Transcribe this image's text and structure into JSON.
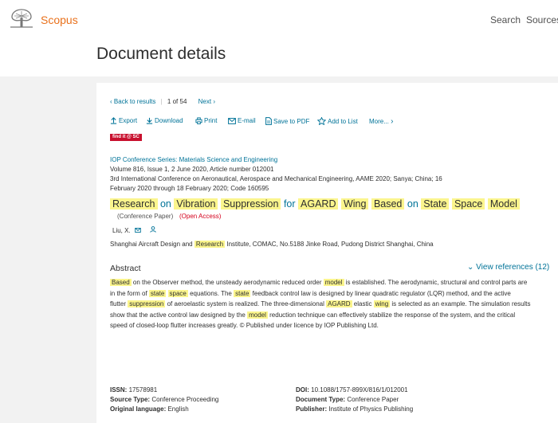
{
  "header": {
    "brand": "Scopus",
    "nav": {
      "search": "Search",
      "sources": "Sources"
    }
  },
  "page": {
    "title": "Document details"
  },
  "resultnav": {
    "back": "Back to results",
    "current": "1",
    "of": "of",
    "total": "54",
    "next": "Next"
  },
  "toolbar": {
    "export": "Export",
    "download": "Download",
    "print": "Print",
    "email": "E-mail",
    "save_pdf": "Save to PDF",
    "add_list": "Add to List",
    "more": "More..."
  },
  "findit": "find it @ SC",
  "source": {
    "journal": "IOP Conference Series: Materials Science and Engineering",
    "volume": "Volume 816, Issue 1, 2 June 2020, Article number 012001",
    "conference_line1": "3rd International Conference on Aeronautical, Aerospace and Mechanical Engineering, AAME 2020; Sanya; China; 16",
    "conference_line2": "February 2020 through 18 February 2020; Code 160595"
  },
  "document": {
    "title_words": [
      "Research",
      "on",
      "Vibration",
      "Suppression",
      "for",
      "AGARD",
      "Wing",
      "Based",
      "on",
      "State",
      "Space",
      "Model"
    ],
    "type": "(Conference Paper)",
    "access": "(Open Access)",
    "author": "Liu, X.",
    "affiliation": {
      "pre": "Shanghai Aircraft Design and",
      "hl": "Research",
      "post": "Institute, COMAC, No.5188 Jinke Road, Pudong District Shanghai, China"
    }
  },
  "abstract": {
    "heading": "Abstract",
    "view_refs": "View references (12)",
    "lines": [
      [
        {
          "t": "Based",
          "h": true
        },
        {
          "t": " on the Observer method, the unsteady aerodynamic reduced order "
        },
        {
          "t": "model",
          "h": true
        },
        {
          "t": " is established. The aerodynamic, structural and control parts are"
        }
      ],
      [
        {
          "t": "in the form of "
        },
        {
          "t": "state",
          "h": true
        },
        {
          "t": " "
        },
        {
          "t": "space",
          "h": true
        },
        {
          "t": " equations. The "
        },
        {
          "t": "state",
          "h": true
        },
        {
          "t": " feedback control law is designed by linear quadratic regulator (LQR) method, and the active"
        }
      ],
      [
        {
          "t": "flutter "
        },
        {
          "t": "suppression",
          "h": true
        },
        {
          "t": " of aeroelastic system is realized. The three-dimensional "
        },
        {
          "t": "AGARD",
          "h": true
        },
        {
          "t": " elastic "
        },
        {
          "t": "wing",
          "h": true
        },
        {
          "t": " is selected as an example. The simulation results"
        }
      ],
      [
        {
          "t": "show that the active control law designed by the "
        },
        {
          "t": "model",
          "h": true
        },
        {
          "t": " reduction technique can effectively stabilize the response of the system, and the critical"
        }
      ],
      [
        {
          "t": "speed of closed-loop flutter increases greatly. © Published under licence by IOP Publishing Ltd."
        }
      ]
    ]
  },
  "meta": {
    "issn": {
      "k": "ISSN:",
      "v": "17578981"
    },
    "source_type": {
      "k": "Source Type:",
      "v": "Conference Proceeding"
    },
    "language": {
      "k": "Original language:",
      "v": "English"
    },
    "doi": {
      "k": "DOI:",
      "v": "10.1088/1757-899X/816/1/012001"
    },
    "doc_type": {
      "k": "Document Type:",
      "v": "Conference Paper"
    },
    "publisher": {
      "k": "Publisher:",
      "v": "Institute of Physics Publishing"
    }
  },
  "colors": {
    "link": "#007398",
    "brand": "#e9711c",
    "highlight": "#fbf58d",
    "open_access": "#d4001c"
  }
}
